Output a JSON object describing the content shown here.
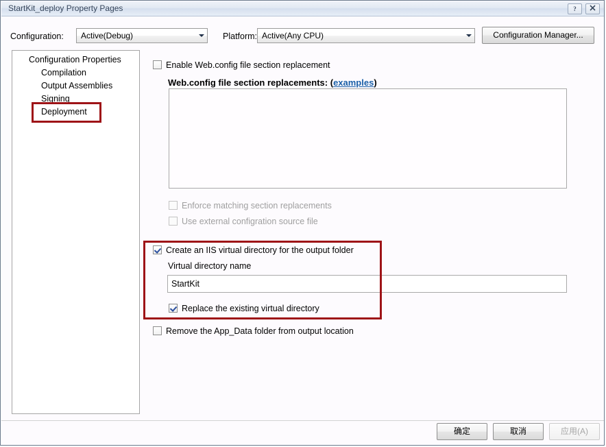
{
  "window": {
    "title": "StartKit_deploy Property Pages",
    "help_icon": "help-icon",
    "close_icon": "close-icon"
  },
  "config_bar": {
    "configuration_label": "Configuration:",
    "configuration_value": "Active(Debug)",
    "platform_label": "Platform:",
    "platform_value": "Active(Any CPU)",
    "configuration_manager_button": "Configuration Manager..."
  },
  "tree": {
    "items": [
      {
        "label": "Configuration Properties",
        "level": 0,
        "selected": false
      },
      {
        "label": "Compilation",
        "level": 1,
        "selected": false
      },
      {
        "label": "Output Assemblies",
        "level": 1,
        "selected": false
      },
      {
        "label": "Signing",
        "level": 1,
        "selected": false
      },
      {
        "label": "Deployment",
        "level": 1,
        "selected": true
      }
    ]
  },
  "main": {
    "enable_webconfig": {
      "label": "Enable Web.config file section replacement",
      "checked": false,
      "enabled": true
    },
    "replacements_heading": "Web.config file section replacements:",
    "replacements_heading_accel": "r",
    "examples_link": "examples",
    "bracket_open": "(",
    "bracket_close": ")",
    "replacements_textarea_value": "",
    "enforce_matching": {
      "label": "Enforce matching section replacements",
      "checked": false,
      "enabled": false
    },
    "use_external": {
      "label": "Use external configration source file",
      "checked": false,
      "enabled": false
    },
    "create_iis": {
      "label": "Create an IIS virtual directory for the output folder",
      "checked": true,
      "enabled": true
    },
    "virtual_dir_name_label": "Virtual directory name",
    "virtual_dir_name_value": "StartKit",
    "replace_existing": {
      "label": "Replace the existing virtual directory",
      "checked": true,
      "enabled": true
    },
    "remove_appdata": {
      "label": "Remove the App_Data folder from output location",
      "checked": false,
      "enabled": true
    }
  },
  "footer": {
    "ok_label": "确定",
    "cancel_label": "取消",
    "apply_label": "应用(A)",
    "apply_enabled": false
  },
  "annotations": {
    "highlight_color": "#9e1317",
    "boxes": [
      "deployment-tree-item",
      "create-iis-virtual-directory-section"
    ]
  }
}
